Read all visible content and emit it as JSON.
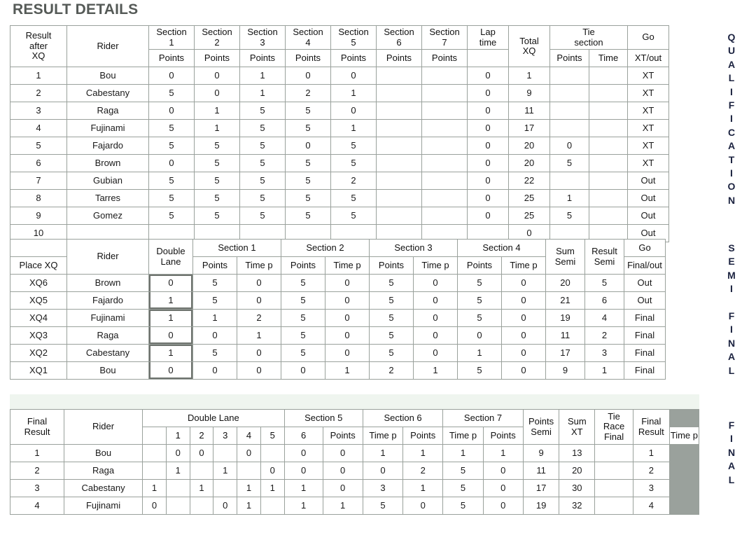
{
  "page": {
    "title": "RESULT DETAILS"
  },
  "side_labels": {
    "qualification": "QUALIFICATION",
    "semi_final": "SEMI FINAL",
    "final": "FINAL"
  },
  "qualification": {
    "headers_row1": [
      "Result after XQ",
      "Rider",
      "Section 1",
      "Section 2",
      "Section 3",
      "Section 4",
      "Section 5",
      "Section 6",
      "Section 7",
      "Lap time",
      "Total XQ",
      "Tie section",
      "Go"
    ],
    "headers_row2": [
      "",
      "",
      "Points",
      "Points",
      "Points",
      "Points",
      "Points",
      "Points",
      "Points",
      "Points",
      "",
      "Points",
      "Time",
      "XT/out"
    ],
    "rows": [
      {
        "place": "1",
        "rider": "Bou",
        "s1": "0",
        "s2": "0",
        "s3": "1",
        "s4": "0",
        "s5": "0",
        "s6": "",
        "s7": "",
        "lap": "0",
        "total": "1",
        "tie_points": "",
        "tie_time": "",
        "go": "XT"
      },
      {
        "place": "2",
        "rider": "Cabestany",
        "s1": "5",
        "s2": "0",
        "s3": "1",
        "s4": "2",
        "s5": "1",
        "s6": "",
        "s7": "",
        "lap": "0",
        "total": "9",
        "tie_points": "",
        "tie_time": "",
        "go": "XT"
      },
      {
        "place": "3",
        "rider": "Raga",
        "s1": "0",
        "s2": "1",
        "s3": "5",
        "s4": "5",
        "s5": "0",
        "s6": "",
        "s7": "",
        "lap": "0",
        "total": "11",
        "tie_points": "",
        "tie_time": "",
        "go": "XT"
      },
      {
        "place": "4",
        "rider": "Fujinami",
        "s1": "5",
        "s2": "1",
        "s3": "5",
        "s4": "5",
        "s5": "1",
        "s6": "",
        "s7": "",
        "lap": "0",
        "total": "17",
        "tie_points": "",
        "tie_time": "",
        "go": "XT"
      },
      {
        "place": "5",
        "rider": "Fajardo",
        "s1": "5",
        "s2": "5",
        "s3": "5",
        "s4": "0",
        "s5": "5",
        "s6": "",
        "s7": "",
        "lap": "0",
        "total": "20",
        "tie_points": "0",
        "tie_time": "",
        "go": "XT"
      },
      {
        "place": "6",
        "rider": "Brown",
        "s1": "0",
        "s2": "5",
        "s3": "5",
        "s4": "5",
        "s5": "5",
        "s6": "",
        "s7": "",
        "lap": "0",
        "total": "20",
        "tie_points": "5",
        "tie_time": "",
        "go": "XT"
      },
      {
        "place": "7",
        "rider": "Gubian",
        "s1": "5",
        "s2": "5",
        "s3": "5",
        "s4": "5",
        "s5": "2",
        "s6": "",
        "s7": "",
        "lap": "0",
        "total": "22",
        "tie_points": "",
        "tie_time": "",
        "go": "Out"
      },
      {
        "place": "8",
        "rider": "Tarres",
        "s1": "5",
        "s2": "5",
        "s3": "5",
        "s4": "5",
        "s5": "5",
        "s6": "",
        "s7": "",
        "lap": "0",
        "total": "25",
        "tie_points": "1",
        "tie_time": "",
        "go": "Out"
      },
      {
        "place": "9",
        "rider": "Gomez",
        "s1": "5",
        "s2": "5",
        "s3": "5",
        "s4": "5",
        "s5": "5",
        "s6": "",
        "s7": "",
        "lap": "0",
        "total": "25",
        "tie_points": "5",
        "tie_time": "",
        "go": "Out"
      },
      {
        "place": "10",
        "rider": "",
        "s1": "",
        "s2": "",
        "s3": "",
        "s4": "",
        "s5": "",
        "s6": "",
        "s7": "",
        "lap": "",
        "total": "0",
        "tie_points": "",
        "tie_time": "",
        "go": "Out"
      }
    ]
  },
  "semi": {
    "headers_row1": [
      "",
      "Rider",
      "Double Lane",
      "Section 1",
      "Section 2",
      "Section 3",
      "Section 4",
      "Sum Semi",
      "Result Semi",
      "Go"
    ],
    "headers_row2": [
      "Place XQ",
      "",
      "",
      "Points",
      "Time p",
      "Points",
      "Time p",
      "Points",
      "Time p",
      "Points",
      "Time p",
      "",
      "",
      "Final/out"
    ],
    "rows": [
      {
        "place": "XQ6",
        "rider": "Brown",
        "lane": "0",
        "s1p": "5",
        "s1t": "0",
        "s2p": "5",
        "s2t": "0",
        "s3p": "5",
        "s3t": "0",
        "s4p": "5",
        "s4t": "0",
        "sum": "20",
        "result": "5",
        "go": "Out",
        "pair": "a",
        "pair_pos": "top"
      },
      {
        "place": "XQ5",
        "rider": "Fajardo",
        "lane": "1",
        "s1p": "5",
        "s1t": "0",
        "s2p": "5",
        "s2t": "0",
        "s3p": "5",
        "s3t": "0",
        "s4p": "5",
        "s4t": "0",
        "sum": "21",
        "result": "6",
        "go": "Out",
        "pair": "a",
        "pair_pos": "bot"
      },
      {
        "place": "XQ4",
        "rider": "Fujinami",
        "lane": "1",
        "s1p": "1",
        "s1t": "2",
        "s2p": "5",
        "s2t": "0",
        "s3p": "5",
        "s3t": "0",
        "s4p": "5",
        "s4t": "0",
        "sum": "19",
        "result": "4",
        "go": "Final",
        "pair": "b",
        "pair_pos": "top"
      },
      {
        "place": "XQ3",
        "rider": "Raga",
        "lane": "0",
        "s1p": "0",
        "s1t": "1",
        "s2p": "5",
        "s2t": "0",
        "s3p": "5",
        "s3t": "0",
        "s4p": "0",
        "s4t": "0",
        "sum": "11",
        "result": "2",
        "go": "Final",
        "pair": "b",
        "pair_pos": "bot"
      },
      {
        "place": "XQ2",
        "rider": "Cabestany",
        "lane": "1",
        "s1p": "5",
        "s1t": "0",
        "s2p": "5",
        "s2t": "0",
        "s3p": "5",
        "s3t": "0",
        "s4p": "1",
        "s4t": "0",
        "sum": "17",
        "result": "3",
        "go": "Final",
        "pair": "c",
        "pair_pos": "top"
      },
      {
        "place": "XQ1",
        "rider": "Bou",
        "lane": "0",
        "s1p": "0",
        "s1t": "0",
        "s2p": "0",
        "s2t": "1",
        "s3p": "2",
        "s3t": "1",
        "s4p": "5",
        "s4t": "0",
        "sum": "9",
        "result": "1",
        "go": "Final",
        "pair": "c",
        "pair_pos": "bot"
      }
    ]
  },
  "final": {
    "headers_row1": [
      "Final Result",
      "Rider",
      "Double Lane",
      "Section 5",
      "Section 6",
      "Section 7",
      "Points Semi",
      "Sum XT",
      "Tie Race Final",
      "Final Result"
    ],
    "headers_row2": [
      "",
      "",
      "1",
      "2",
      "3",
      "4",
      "5",
      "6",
      "Points",
      "Time p",
      "Points",
      "Time p",
      "Points",
      "Time p",
      "",
      "",
      "",
      ""
    ],
    "rows": [
      {
        "place": "1",
        "rider": "Bou",
        "d1": "",
        "d2": "0",
        "d3": "0",
        "d4": "",
        "d5": "0",
        "d6": "",
        "s5p": "0",
        "s5t": "0",
        "s6p": "1",
        "s6t": "1",
        "s7p": "1",
        "s7t": "1",
        "points_semi": "9",
        "sum_xt": "13",
        "tie_race": "",
        "final_result": "1"
      },
      {
        "place": "2",
        "rider": "Raga",
        "d1": "",
        "d2": "1",
        "d3": "",
        "d4": "1",
        "d5": "",
        "d6": "0",
        "s5p": "0",
        "s5t": "0",
        "s6p": "0",
        "s6t": "2",
        "s7p": "5",
        "s7t": "0",
        "points_semi": "11",
        "sum_xt": "20",
        "tie_race": "",
        "final_result": "2"
      },
      {
        "place": "3",
        "rider": "Cabestany",
        "d1": "1",
        "d2": "",
        "d3": "1",
        "d4": "",
        "d5": "1",
        "d6": "1",
        "s5p": "1",
        "s5t": "0",
        "s6p": "3",
        "s6t": "1",
        "s7p": "5",
        "s7t": "0",
        "points_semi": "17",
        "sum_xt": "30",
        "tie_race": "",
        "final_result": "3"
      },
      {
        "place": "4",
        "rider": "Fujinami",
        "d1": "0",
        "d2": "",
        "d3": "",
        "d4": "0",
        "d5": "1",
        "d6": "",
        "s5p": "1",
        "s5t": "1",
        "s6p": "5",
        "s6t": "0",
        "s7p": "5",
        "s7t": "0",
        "points_semi": "19",
        "sum_xt": "32",
        "tie_race": "",
        "final_result": "4"
      }
    ]
  },
  "colors": {
    "title": "#555a57",
    "header_gradient_top": "#f2f6f1",
    "header_gradient_bottom": "#c9cdc6",
    "grid_line": "#9aa19c",
    "final_band": "#eff5ef",
    "side_label": "#1c2340"
  }
}
